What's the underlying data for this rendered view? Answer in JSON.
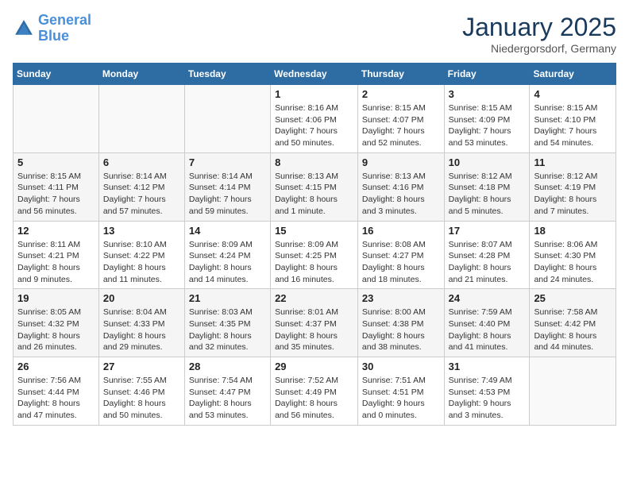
{
  "logo": {
    "line1": "General",
    "line2": "Blue"
  },
  "title": "January 2025",
  "subtitle": "Niedergorsdorf, Germany",
  "weekdays": [
    "Sunday",
    "Monday",
    "Tuesday",
    "Wednesday",
    "Thursday",
    "Friday",
    "Saturday"
  ],
  "weeks": [
    [
      {
        "day": "",
        "info": ""
      },
      {
        "day": "",
        "info": ""
      },
      {
        "day": "",
        "info": ""
      },
      {
        "day": "1",
        "info": "Sunrise: 8:16 AM\nSunset: 4:06 PM\nDaylight: 7 hours\nand 50 minutes."
      },
      {
        "day": "2",
        "info": "Sunrise: 8:15 AM\nSunset: 4:07 PM\nDaylight: 7 hours\nand 52 minutes."
      },
      {
        "day": "3",
        "info": "Sunrise: 8:15 AM\nSunset: 4:09 PM\nDaylight: 7 hours\nand 53 minutes."
      },
      {
        "day": "4",
        "info": "Sunrise: 8:15 AM\nSunset: 4:10 PM\nDaylight: 7 hours\nand 54 minutes."
      }
    ],
    [
      {
        "day": "5",
        "info": "Sunrise: 8:15 AM\nSunset: 4:11 PM\nDaylight: 7 hours\nand 56 minutes."
      },
      {
        "day": "6",
        "info": "Sunrise: 8:14 AM\nSunset: 4:12 PM\nDaylight: 7 hours\nand 57 minutes."
      },
      {
        "day": "7",
        "info": "Sunrise: 8:14 AM\nSunset: 4:14 PM\nDaylight: 7 hours\nand 59 minutes."
      },
      {
        "day": "8",
        "info": "Sunrise: 8:13 AM\nSunset: 4:15 PM\nDaylight: 8 hours\nand 1 minute."
      },
      {
        "day": "9",
        "info": "Sunrise: 8:13 AM\nSunset: 4:16 PM\nDaylight: 8 hours\nand 3 minutes."
      },
      {
        "day": "10",
        "info": "Sunrise: 8:12 AM\nSunset: 4:18 PM\nDaylight: 8 hours\nand 5 minutes."
      },
      {
        "day": "11",
        "info": "Sunrise: 8:12 AM\nSunset: 4:19 PM\nDaylight: 8 hours\nand 7 minutes."
      }
    ],
    [
      {
        "day": "12",
        "info": "Sunrise: 8:11 AM\nSunset: 4:21 PM\nDaylight: 8 hours\nand 9 minutes."
      },
      {
        "day": "13",
        "info": "Sunrise: 8:10 AM\nSunset: 4:22 PM\nDaylight: 8 hours\nand 11 minutes."
      },
      {
        "day": "14",
        "info": "Sunrise: 8:09 AM\nSunset: 4:24 PM\nDaylight: 8 hours\nand 14 minutes."
      },
      {
        "day": "15",
        "info": "Sunrise: 8:09 AM\nSunset: 4:25 PM\nDaylight: 8 hours\nand 16 minutes."
      },
      {
        "day": "16",
        "info": "Sunrise: 8:08 AM\nSunset: 4:27 PM\nDaylight: 8 hours\nand 18 minutes."
      },
      {
        "day": "17",
        "info": "Sunrise: 8:07 AM\nSunset: 4:28 PM\nDaylight: 8 hours\nand 21 minutes."
      },
      {
        "day": "18",
        "info": "Sunrise: 8:06 AM\nSunset: 4:30 PM\nDaylight: 8 hours\nand 24 minutes."
      }
    ],
    [
      {
        "day": "19",
        "info": "Sunrise: 8:05 AM\nSunset: 4:32 PM\nDaylight: 8 hours\nand 26 minutes."
      },
      {
        "day": "20",
        "info": "Sunrise: 8:04 AM\nSunset: 4:33 PM\nDaylight: 8 hours\nand 29 minutes."
      },
      {
        "day": "21",
        "info": "Sunrise: 8:03 AM\nSunset: 4:35 PM\nDaylight: 8 hours\nand 32 minutes."
      },
      {
        "day": "22",
        "info": "Sunrise: 8:01 AM\nSunset: 4:37 PM\nDaylight: 8 hours\nand 35 minutes."
      },
      {
        "day": "23",
        "info": "Sunrise: 8:00 AM\nSunset: 4:38 PM\nDaylight: 8 hours\nand 38 minutes."
      },
      {
        "day": "24",
        "info": "Sunrise: 7:59 AM\nSunset: 4:40 PM\nDaylight: 8 hours\nand 41 minutes."
      },
      {
        "day": "25",
        "info": "Sunrise: 7:58 AM\nSunset: 4:42 PM\nDaylight: 8 hours\nand 44 minutes."
      }
    ],
    [
      {
        "day": "26",
        "info": "Sunrise: 7:56 AM\nSunset: 4:44 PM\nDaylight: 8 hours\nand 47 minutes."
      },
      {
        "day": "27",
        "info": "Sunrise: 7:55 AM\nSunset: 4:46 PM\nDaylight: 8 hours\nand 50 minutes."
      },
      {
        "day": "28",
        "info": "Sunrise: 7:54 AM\nSunset: 4:47 PM\nDaylight: 8 hours\nand 53 minutes."
      },
      {
        "day": "29",
        "info": "Sunrise: 7:52 AM\nSunset: 4:49 PM\nDaylight: 8 hours\nand 56 minutes."
      },
      {
        "day": "30",
        "info": "Sunrise: 7:51 AM\nSunset: 4:51 PM\nDaylight: 9 hours\nand 0 minutes."
      },
      {
        "day": "31",
        "info": "Sunrise: 7:49 AM\nSunset: 4:53 PM\nDaylight: 9 hours\nand 3 minutes."
      },
      {
        "day": "",
        "info": ""
      }
    ]
  ]
}
